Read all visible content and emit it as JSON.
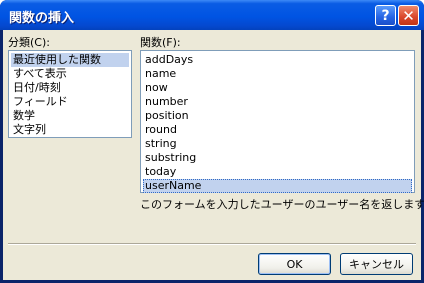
{
  "window": {
    "title": "関数の挿入",
    "help_glyph": "?",
    "close_glyph": "✕"
  },
  "category": {
    "label": "分類(C):",
    "items": [
      "最近使用した関数",
      "すべて表示",
      "日付/時刻",
      "フィールド",
      "数学",
      "文字列"
    ],
    "selected": "最近使用した関数"
  },
  "functions": {
    "label": "関数(F):",
    "items": [
      "addDays",
      "name",
      "now",
      "number",
      "position",
      "round",
      "string",
      "substring",
      "today",
      "userName"
    ],
    "selected": "userName",
    "description": "このフォームを入力したユーザーのユーザー名を返します。"
  },
  "buttons": {
    "ok": "OK",
    "cancel": "キャンセル"
  },
  "colors": {
    "title_bar": "#0054e3",
    "selection": "#c1d2ee",
    "dialog_bg": "#ece9d8"
  }
}
